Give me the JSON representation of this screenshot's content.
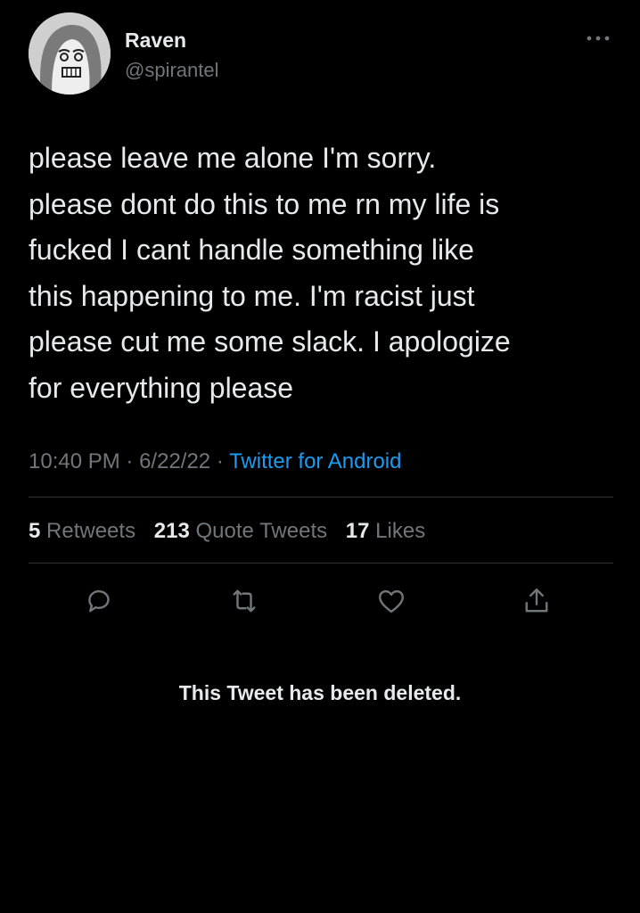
{
  "tweet": {
    "author": {
      "display_name": "Raven",
      "handle": "@spirantel"
    },
    "text": "please leave me alone I'm sorry.\nplease dont do this to me rn my life is\nfucked I cant handle something like\nthis happening to me. I'm racist just\nplease cut me some slack. I apologize\nfor everything please",
    "time": "10:40 PM",
    "separator": "·",
    "date": "6/22/22",
    "source": "Twitter for Android",
    "stats": {
      "retweets_count": "5",
      "retweets_label": "Retweets",
      "quote_tweets_count": "213",
      "quote_tweets_label": "Quote Tweets",
      "likes_count": "17",
      "likes_label": "Likes"
    },
    "actions": {
      "reply_icon": "reply-icon",
      "retweet_icon": "retweet-icon",
      "like_icon": "heart-icon",
      "share_icon": "share-icon",
      "more_icon": "more-icon"
    }
  },
  "notice": {
    "deleted_text": "This Tweet has been deleted."
  },
  "colors": {
    "background": "#000000",
    "primary_text": "#e7e9ea",
    "secondary_text": "#71767b",
    "link": "#1d9bf0",
    "divider": "#2f3336"
  }
}
